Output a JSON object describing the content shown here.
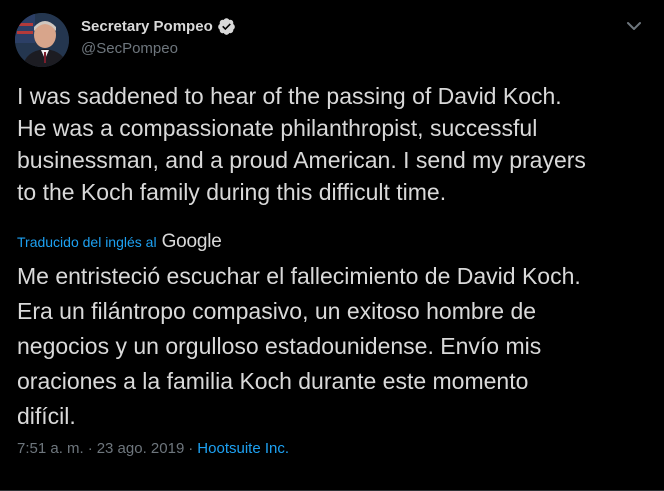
{
  "user": {
    "display_name": "Secretary Pompeo",
    "handle": "@SecPompeo"
  },
  "tweet": {
    "text": "I was saddened to hear of the passing of David Koch.\nHe was a compassionate philanthropist, successful\nbusinessman, and a proud American. I send my prayers\nto the Koch family during this difficult time."
  },
  "translation": {
    "label": "Traducido del inglés al",
    "provider": "Google",
    "text": "Me entristeció escuchar el fallecimiento de David Koch.\nEra un filántropo compasivo, un exitoso hombre de\nnegocios y un orgulloso estadounidense. Envío mis\noraciones a la familia Koch durante este momento\ndifícil."
  },
  "meta": {
    "time": "7:51 a. m.",
    "separator": "·",
    "date": "23 ago. 2019",
    "source": "Hootsuite Inc."
  },
  "icons": {
    "verified": "verified-badge-icon",
    "menu": "chevron-down-icon"
  },
  "colors": {
    "background": "#000000",
    "text": "#D9D9D9",
    "secondary_text": "#6E767D",
    "accent": "#1DA1F2"
  }
}
